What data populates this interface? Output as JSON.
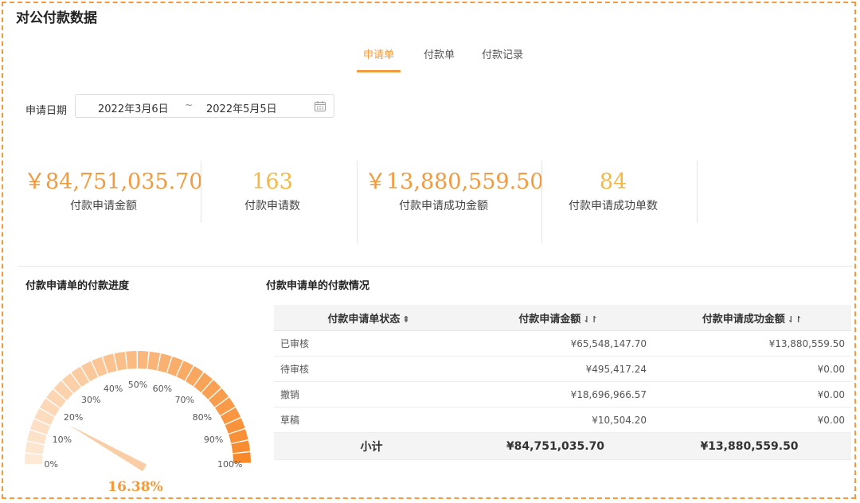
{
  "page_title": "对公付款数据",
  "tabs": [
    {
      "label": "申请单",
      "active": true
    },
    {
      "label": "付款单",
      "active": false
    },
    {
      "label": "付款记录",
      "active": false
    }
  ],
  "filter": {
    "date_label": "申请日期",
    "start_date": "2022年3月6日",
    "separator": "~",
    "end_date": "2022年5月5日"
  },
  "stats": [
    {
      "value": "￥84,751,035.70",
      "label": "付款申请金额"
    },
    {
      "value": "163",
      "label": "付款申请数"
    },
    {
      "value": "￥13,880,559.50",
      "label": "付款申请成功金额"
    },
    {
      "value": "84",
      "label": "付款申请成功单数"
    }
  ],
  "gauge": {
    "title": "付款申请单的付款进度",
    "value_percent": 16.38,
    "value_label": "16.38%",
    "tick_labels": [
      "0%",
      "10%",
      "20%",
      "30%",
      "40%",
      "50%",
      "60%",
      "70%",
      "80%",
      "90%",
      "100%"
    ]
  },
  "table": {
    "title": "付款申请单的付款情况",
    "columns": [
      "付款申请单状态",
      "付款申请金额",
      "付款申请成功金额"
    ],
    "rows": [
      [
        "已审核",
        "¥65,548,147.70",
        "¥13,880,559.50"
      ],
      [
        "待审核",
        "¥495,417.24",
        "¥0.00"
      ],
      [
        "撤销",
        "¥18,696,966.57",
        "¥0.00"
      ],
      [
        "草稿",
        "¥10,504.20",
        "¥0.00"
      ]
    ],
    "total": [
      "小计",
      "¥84,751,035.70",
      "¥13,880,559.50"
    ]
  },
  "colors": {
    "accent": "#f39a3d",
    "accent_light": "#f5b943",
    "gauge_start": "#fde9d6",
    "gauge_end": "#f7892a"
  }
}
